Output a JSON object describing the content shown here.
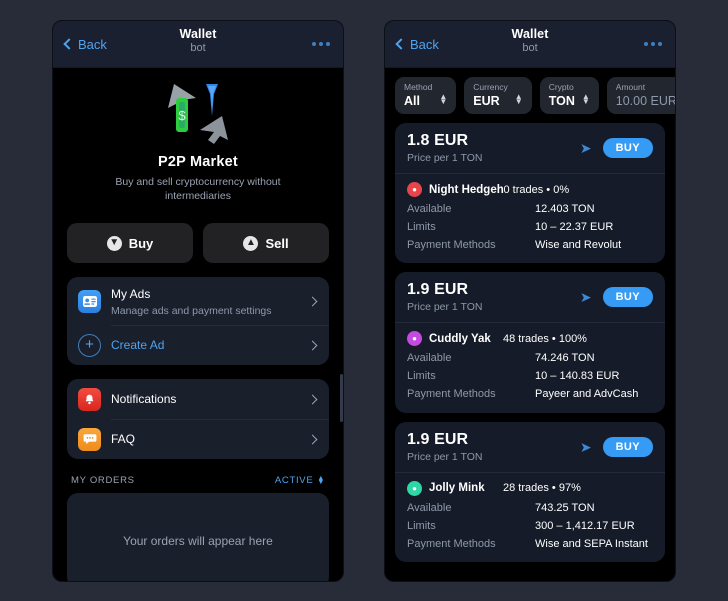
{
  "left": {
    "header": {
      "back": "Back",
      "title": "Wallet",
      "subtitle": "bot",
      "menu_icon": "more-icon"
    },
    "hero": {
      "title": "P2P Market",
      "subtitle": "Buy and sell cryptocurrency without intermediaries"
    },
    "actions": [
      {
        "label": "Buy",
        "icon": "arrow-down-circle-icon"
      },
      {
        "label": "Sell",
        "icon": "arrow-up-circle-icon"
      }
    ],
    "menu_group_1": [
      {
        "icon": "id-card-icon",
        "title": "My Ads",
        "subtitle": "Manage ads and payment settings",
        "link": false
      },
      {
        "icon": "plus-circle-icon",
        "title": "Create Ad",
        "subtitle": "",
        "link": true
      }
    ],
    "menu_group_2": [
      {
        "icon": "bell-icon",
        "title": "Notifications",
        "subtitle": "",
        "link": false
      },
      {
        "icon": "chat-bubble-icon",
        "title": "FAQ",
        "subtitle": "",
        "link": false
      }
    ],
    "orders": {
      "label": "MY ORDERS",
      "filter": "ACTIVE",
      "empty_text": "Your orders will appear here"
    }
  },
  "right": {
    "header": {
      "back": "Back",
      "title": "Wallet",
      "subtitle": "bot",
      "menu_icon": "more-icon"
    },
    "filters": [
      {
        "label": "Method",
        "value": "All",
        "dim": false
      },
      {
        "label": "Currency",
        "value": "EUR",
        "dim": false
      },
      {
        "label": "Crypto",
        "value": "TON",
        "dim": false
      },
      {
        "label": "Amount",
        "value": "10.00 EUR",
        "dim": true
      }
    ],
    "offers": [
      {
        "price": "1.8 EUR",
        "price_sub": "Price per 1 TON",
        "buy_label": "BUY",
        "share_icon": "share-arrow-icon",
        "seller": "Night Hedgeh",
        "avatar_color": "#e8454a",
        "stats": "0 trades • 0%",
        "rows": [
          {
            "k": "Available",
            "v": "12.403 TON"
          },
          {
            "k": "Limits",
            "v": "10 – 22.37 EUR"
          },
          {
            "k": "Payment Methods",
            "v": "Wise and Revolut"
          }
        ]
      },
      {
        "price": "1.9 EUR",
        "price_sub": "Price per 1 TON",
        "buy_label": "BUY",
        "share_icon": "share-arrow-icon",
        "seller": "Cuddly Yak",
        "avatar_color": "#c44ae0",
        "stats": "48 trades • 100%",
        "rows": [
          {
            "k": "Available",
            "v": "74.246 TON"
          },
          {
            "k": "Limits",
            "v": "10 – 140.83 EUR"
          },
          {
            "k": "Payment Methods",
            "v": "Payeer and AdvCash"
          }
        ]
      },
      {
        "price": "1.9 EUR",
        "price_sub": "Price per 1 TON",
        "buy_label": "BUY",
        "share_icon": "share-arrow-icon",
        "seller": "Jolly Mink",
        "avatar_color": "#2fd6a6",
        "stats": "28 trades • 97%",
        "rows": [
          {
            "k": "Available",
            "v": "743.25 TON"
          },
          {
            "k": "Limits",
            "v": "300 – 1,412.17 EUR"
          },
          {
            "k": "Payment Methods",
            "v": "Wise and SEPA Instant"
          }
        ]
      }
    ]
  }
}
